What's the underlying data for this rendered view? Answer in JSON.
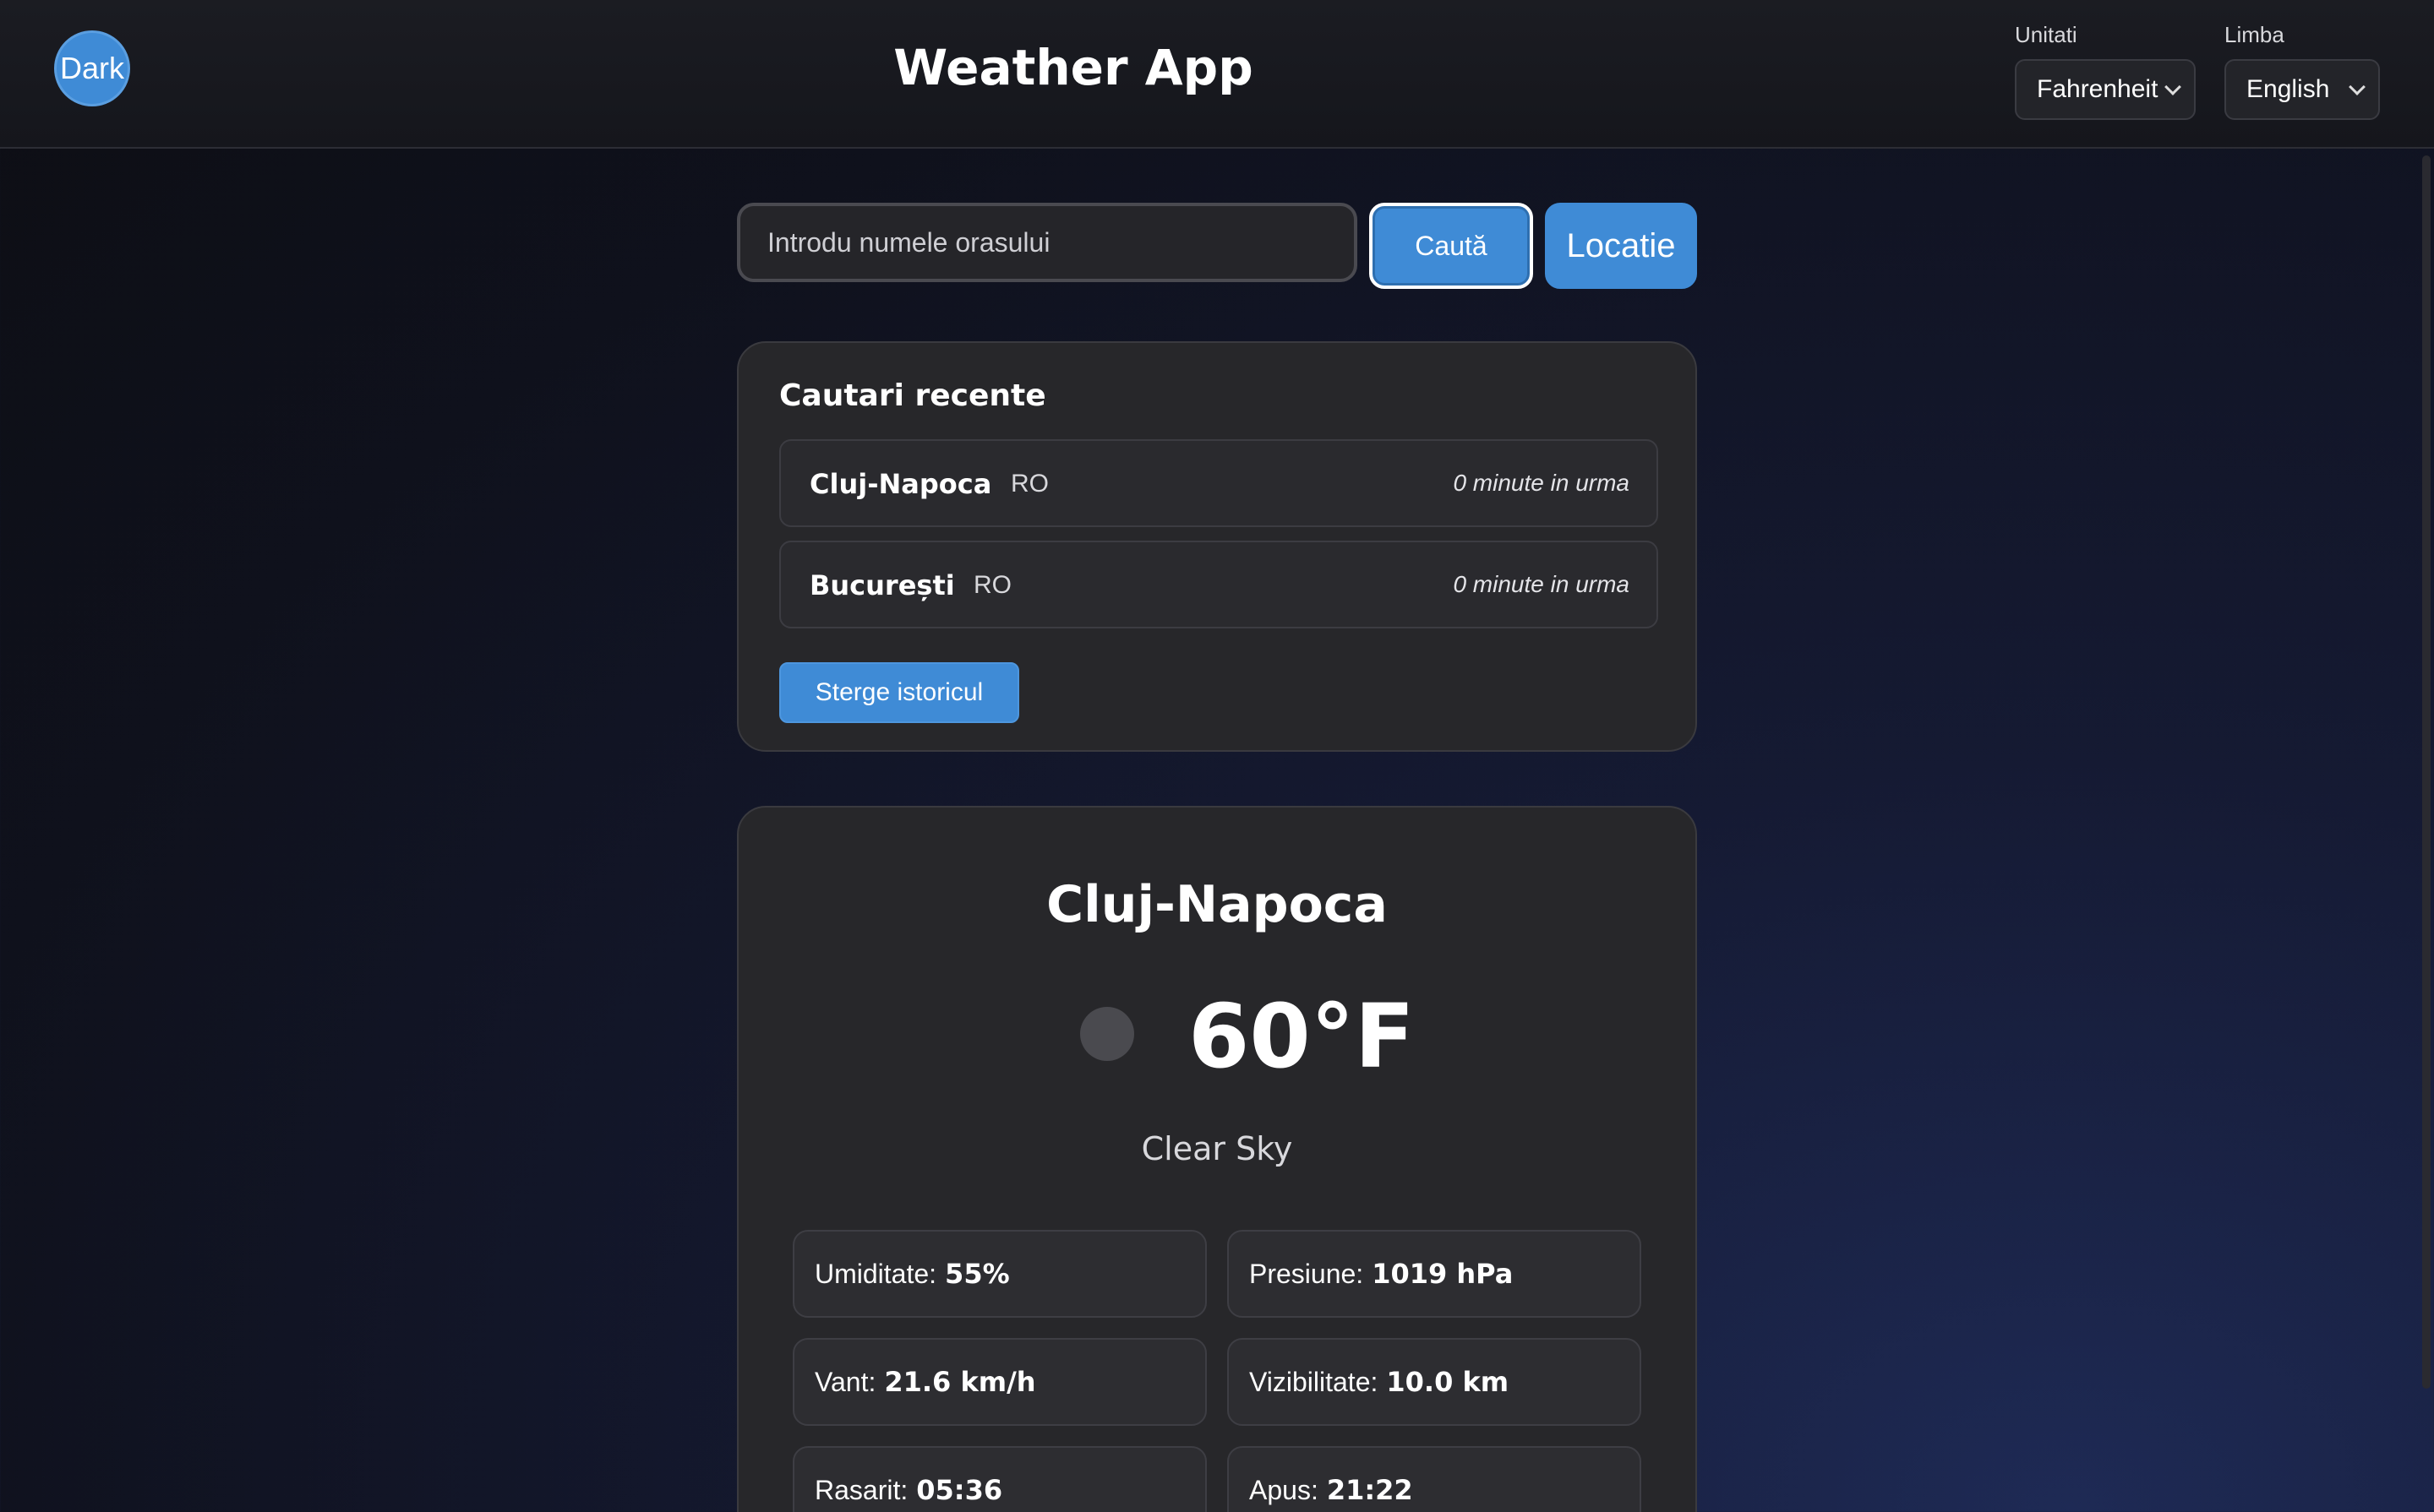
{
  "header": {
    "theme_toggle": "Dark",
    "title": "Weather App",
    "units_label": "Unitati",
    "units_value": "Fahrenheit",
    "language_label": "Limba",
    "language_value": "English"
  },
  "search": {
    "placeholder": "Introdu numele orasului",
    "search_button": "Caută",
    "location_button": "Locatie"
  },
  "recent": {
    "title": "Cautari recente",
    "items": [
      {
        "city": "Cluj-Napoca",
        "country": "RO",
        "time": "0 minute in urma"
      },
      {
        "city": "București",
        "country": "RO",
        "time": "0 minute in urma"
      }
    ],
    "clear_button": "Sterge istoricul"
  },
  "weather": {
    "city": "Cluj-Napoca",
    "temperature": "60°F",
    "description": "Clear Sky",
    "icon": "weather-condition-icon",
    "details": [
      {
        "label": "Umiditate:",
        "value": "55%"
      },
      {
        "label": "Presiune:",
        "value": "1019 hPa"
      },
      {
        "label": "Vant:",
        "value": "21.6 km/h"
      },
      {
        "label": "Vizibilitate:",
        "value": "10.0 km"
      },
      {
        "label": "Rasarit:",
        "value": "05:36"
      },
      {
        "label": "Apus:",
        "value": "21:22"
      }
    ]
  },
  "colors": {
    "accent": "#3f8bd6",
    "card": "#27272a",
    "header": "#18191f"
  }
}
